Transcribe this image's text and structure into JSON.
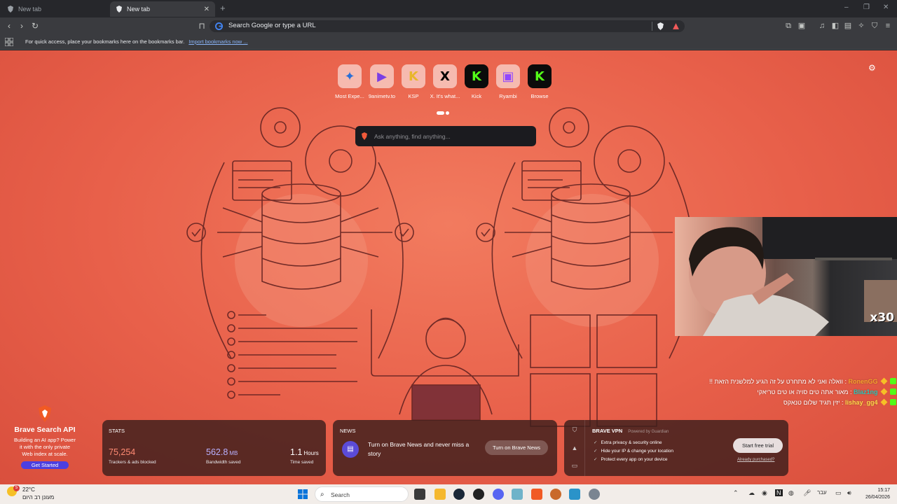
{
  "browser": {
    "tabs": [
      {
        "label": "New tab",
        "active": false
      },
      {
        "label": "New tab",
        "active": true
      }
    ],
    "new_tab_symbol": "+",
    "window_controls": [
      "–",
      "❐",
      "✕"
    ],
    "omnibox": {
      "text": "Search Google or type a URL"
    },
    "bookmarks_bar": {
      "message": "For quick access, place your bookmarks here on the bookmarks bar.",
      "import_link": "Import bookmarks now ..."
    }
  },
  "ntp": {
    "top_sites": [
      {
        "label": "Most Expe...",
        "glyph": "✦",
        "color": "#2a6fd6"
      },
      {
        "label": "9animetv.to",
        "glyph": "▶",
        "color": "#7b3fe4"
      },
      {
        "label": "KSP",
        "glyph": "K",
        "color": "#3b6fd6"
      },
      {
        "label": "X. It's what...",
        "glyph": "X",
        "color": "#000000"
      },
      {
        "label": "Kick",
        "glyph": "K",
        "color": "#53fc18"
      },
      {
        "label": "Ryambi",
        "glyph": "▣",
        "color": "#9146ff"
      },
      {
        "label": "Browse",
        "glyph": "K",
        "color": "#53fc18"
      }
    ],
    "search_placeholder": "Ask anything, find anything...",
    "brave_api": {
      "title": "Brave Search API",
      "desc_lines": [
        "Building an AI app? Power",
        "it with the only private",
        "Web index at scale."
      ],
      "button": "Get Started"
    },
    "stats": {
      "header": "STATS",
      "items": [
        {
          "value": "75,254",
          "unit": "",
          "caption": "Trackers & ads blocked",
          "color": "#ff8a73"
        },
        {
          "value": "562.8",
          "unit": "MB",
          "caption": "Bandwidth saved",
          "color": "#b9b1ff"
        },
        {
          "value": "1.1",
          "unit": "Hours",
          "caption": "Time saved",
          "color": "#ffffff"
        }
      ]
    },
    "news": {
      "header": "NEWS",
      "text": "Turn on Brave News and never miss a story",
      "button": "Turn on Brave News"
    },
    "vpn": {
      "header": "BRAVE VPN",
      "powered": "Powered by Guardian",
      "features": [
        "Extra privacy & security online",
        "Hide your IP & change your location",
        "Protect every app on your device"
      ],
      "button": "Start free trial",
      "already": "Already purchased?"
    }
  },
  "stream": {
    "overlay_text": "x30",
    "chat": [
      {
        "user": "RonenGG",
        "message": "וואלה ואני לא מתחרט על זה הגיע למלשנית הזאת !!"
      },
      {
        "user": "Blaz1ng",
        "message": "מאור אתה טים סויה או טים טריאקי"
      },
      {
        "user": "lishay_gg4",
        "message": "יזין תגיד שלום טנאקס"
      }
    ]
  },
  "taskbar": {
    "weather_temp": "22°C",
    "weather_badge": "5",
    "weather_text": "מעונן רב היום",
    "search_label": "Search",
    "lang": "עבר",
    "time": "15:17",
    "date": "26/04/2026"
  }
}
